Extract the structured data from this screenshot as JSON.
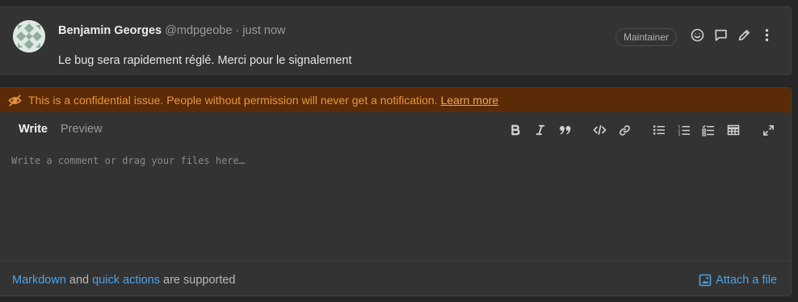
{
  "note": {
    "author_name": "Benjamin Georges",
    "author_handle": "@mdpgeobe",
    "separator": "·",
    "time": "just now",
    "body": "Le bug sera rapidement réglé. Merci pour le signalement",
    "role_badge": "Maintainer",
    "actions": [
      "smiley-icon",
      "comment-icon",
      "pencil-icon",
      "more-vertical-icon"
    ]
  },
  "editor": {
    "banner_text": "This is a confidential issue. People without permission will never get a notification.",
    "banner_link": "Learn more",
    "tabs": {
      "write": "Write",
      "preview": "Preview"
    },
    "toolbar": [
      "bold-icon",
      "italic-icon",
      "quote-icon",
      "code-icon",
      "link-icon",
      "bullet-list-icon",
      "numbered-list-icon",
      "task-list-icon",
      "table-icon",
      "fullscreen-icon"
    ],
    "placeholder": "Write a comment or drag your files here…",
    "footer": {
      "markdown": "Markdown",
      "and": "and",
      "quick_actions": "quick actions",
      "supported": "are supported",
      "attach": "Attach a file"
    }
  },
  "colors": {
    "background": "#262626",
    "panel": "#333333",
    "banner_bg": "#5b2b07",
    "banner_text": "#e8953f",
    "link": "#4da2e6"
  }
}
